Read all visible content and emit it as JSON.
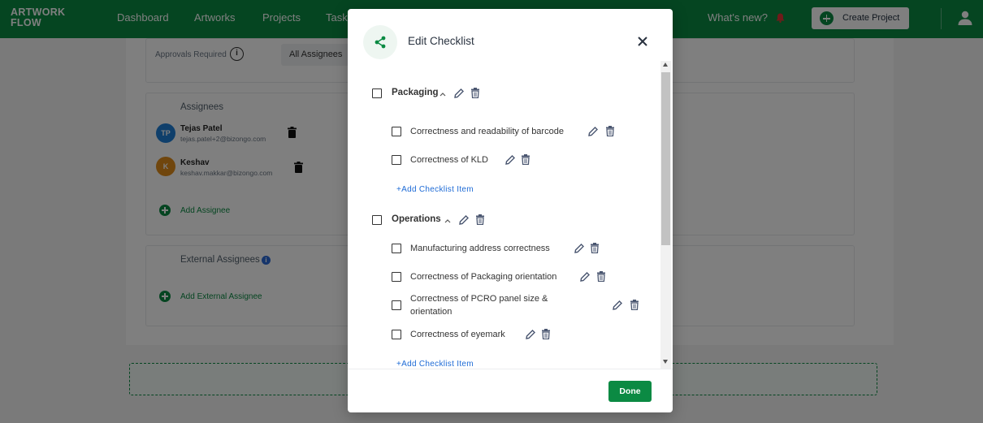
{
  "app": {
    "logo_line1": "ARTWORK",
    "logo_line2": "FLOW",
    "brand_color": "#0b8a43"
  },
  "nav": {
    "items": [
      {
        "label": "Dashboard"
      },
      {
        "label": "Artworks"
      },
      {
        "label": "Projects"
      },
      {
        "label": "Task"
      }
    ],
    "whats_new": "What's new?",
    "create_project": "Create Project"
  },
  "background": {
    "approvals_label": "Approvals Required",
    "approvals_value": "All Assignees",
    "assignees_title": "Assignees",
    "assignees": [
      {
        "initials": "TP",
        "name": "Tejas Patel",
        "email": "tejas.patel+2@bizongo.com",
        "color": "#1f7fd6"
      },
      {
        "initials": "K",
        "name": "Keshav",
        "email": "keshav.makkar@bizongo.com",
        "color": "#e08c1a"
      }
    ],
    "add_assignee": "Add Assignee",
    "external_title": "External Assignees",
    "add_external": "Add External Assignee"
  },
  "modal": {
    "title": "Edit Checklist",
    "done_label": "Done",
    "add_item_label": "+Add Checklist Item",
    "groups": [
      {
        "label": "Packaging",
        "items": [
          {
            "label": "Correctness and readability of barcode"
          },
          {
            "label": "Correctness of KLD"
          }
        ]
      },
      {
        "label": "Operations",
        "items": [
          {
            "label": "Manufacturing address correctness"
          },
          {
            "label": "Correctness of Packaging orientation"
          },
          {
            "label": "Correctness of PCRO panel size & orientation"
          },
          {
            "label": "Correctness of eyemark"
          }
        ]
      }
    ]
  }
}
